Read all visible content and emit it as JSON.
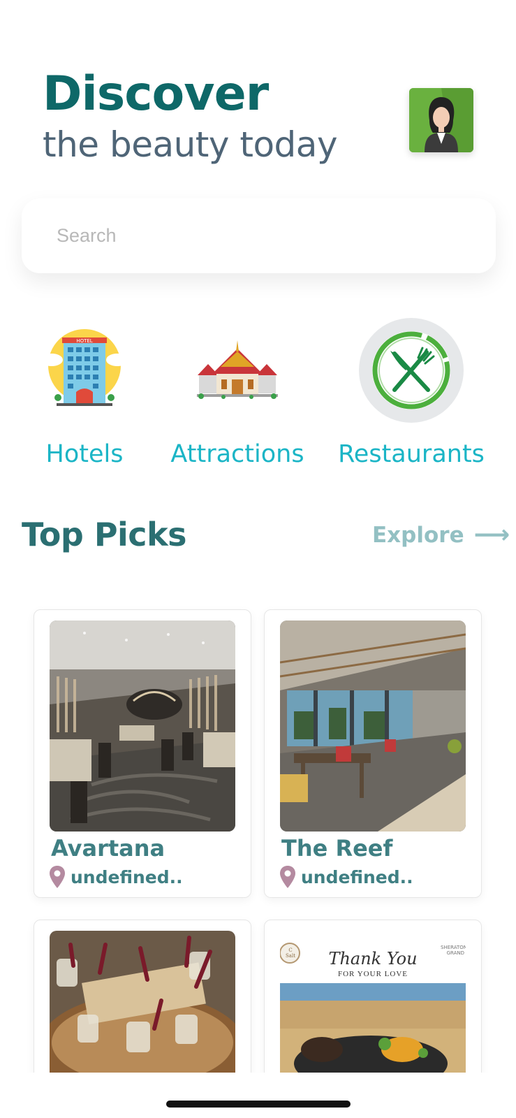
{
  "header": {
    "title": "Discover",
    "subtitle": "the beauty today"
  },
  "search": {
    "placeholder": "Search"
  },
  "categories": [
    {
      "label": "Hotels",
      "icon": "hotel-building-icon"
    },
    {
      "label": "Attractions",
      "icon": "temple-icon"
    },
    {
      "label": "Restaurants",
      "icon": "fork-knife-icon"
    }
  ],
  "top_picks": {
    "title": "Top Picks",
    "explore_label": "Explore",
    "items": [
      {
        "name": "Avartana",
        "location": "undefined.."
      },
      {
        "name": "The Reef",
        "location": "undefined.."
      },
      {
        "name": "",
        "location": ""
      },
      {
        "name": "",
        "location": ""
      }
    ],
    "card4_overlay": {
      "thank_you": "Thank You",
      "for_your_love": "FOR YOUR LOVE",
      "badge_left": "C Salt",
      "badge_right": "SHERATON GRAND"
    }
  },
  "colors": {
    "title": "#0e6868",
    "subtitle": "#4f6577",
    "category_label": "#1bb5c6",
    "section_title": "#2b6f72",
    "explore": "#93c0c3",
    "card_text": "#3f7f83",
    "location_pin": "#b48aa0"
  }
}
